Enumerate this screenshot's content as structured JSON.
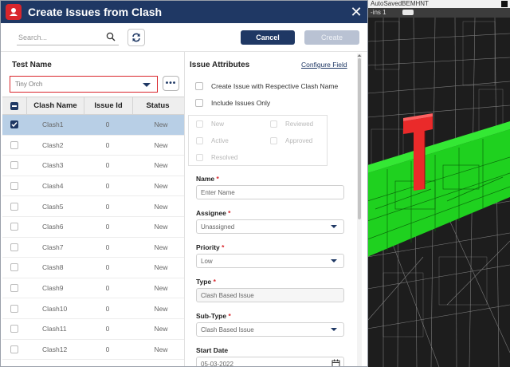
{
  "background_app": {
    "title_fragment": "AutoSavedBEMHNT",
    "tab_fragment": "-ins 1"
  },
  "dialog": {
    "title": "Create Issues from Clash",
    "close_glyph": "✕"
  },
  "toolbar": {
    "search_placeholder": "Search...",
    "cancel_label": "Cancel",
    "create_label": "Create"
  },
  "test": {
    "label": "Test Name",
    "selected": "Tiny Orch",
    "more_label": "•••"
  },
  "grid": {
    "headers": {
      "name": "Clash Name",
      "id": "Issue Id",
      "status": "Status"
    },
    "rows": [
      {
        "name": "Clash1",
        "id": "0",
        "status": "New",
        "checked": true
      },
      {
        "name": "Clash2",
        "id": "0",
        "status": "New",
        "checked": false
      },
      {
        "name": "Clash3",
        "id": "0",
        "status": "New",
        "checked": false
      },
      {
        "name": "Clash4",
        "id": "0",
        "status": "New",
        "checked": false
      },
      {
        "name": "Clash5",
        "id": "0",
        "status": "New",
        "checked": false
      },
      {
        "name": "Clash6",
        "id": "0",
        "status": "New",
        "checked": false
      },
      {
        "name": "Clash7",
        "id": "0",
        "status": "New",
        "checked": false
      },
      {
        "name": "Clash8",
        "id": "0",
        "status": "New",
        "checked": false
      },
      {
        "name": "Clash9",
        "id": "0",
        "status": "New",
        "checked": false
      },
      {
        "name": "Clash10",
        "id": "0",
        "status": "New",
        "checked": false
      },
      {
        "name": "Clash11",
        "id": "0",
        "status": "New",
        "checked": false
      },
      {
        "name": "Clash12",
        "id": "0",
        "status": "New",
        "checked": false
      }
    ]
  },
  "issue_attributes": {
    "title": "Issue Attributes",
    "configure_link": "Configure Field",
    "option_respective_name": "Create Issue with Respective Clash Name",
    "option_issues_only": "Include Issues Only",
    "statuses": {
      "new": "New",
      "reviewed": "Reviewed",
      "active": "Active",
      "approved": "Approved",
      "resolved": "Resolved"
    },
    "name_label": "Name",
    "name_placeholder": "Enter Name",
    "assignee_label": "Assignee",
    "assignee_value": "Unassigned",
    "priority_label": "Priority",
    "priority_value": "Low",
    "type_label": "Type",
    "type_value": "Clash Based Issue",
    "subtype_label": "Sub-Type",
    "subtype_value": "Clash Based Issue",
    "start_date_label": "Start Date",
    "start_date_value": "05-03-2022",
    "required_mark": "*"
  },
  "colors": {
    "primary": "#1f3864",
    "accent_red": "#d9262c",
    "selected_row": "#b8cfe6",
    "clash_green": "#22dd22",
    "clash_red": "#ee2b2b"
  }
}
